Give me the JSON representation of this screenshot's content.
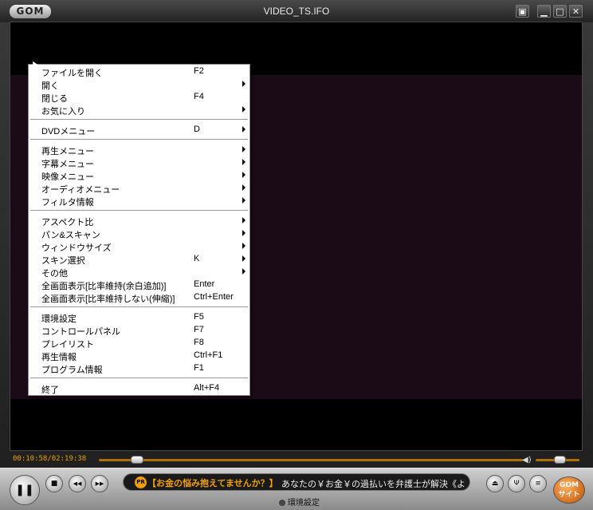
{
  "app": {
    "logo_text": "GOM",
    "title": "VIDEO_TS.IFO"
  },
  "window_buttons": {
    "compact": "▣",
    "minimize": "▁",
    "maximize": "□",
    "close": "✕"
  },
  "context_menu": {
    "items": [
      {
        "label": "ファイルを開く",
        "shortcut": "F2",
        "submenu": false
      },
      {
        "label": "開く",
        "shortcut": "",
        "submenu": true
      },
      {
        "label": "閉じる",
        "shortcut": "F4",
        "submenu": false
      },
      {
        "label": "お気に入り",
        "shortcut": "",
        "submenu": true
      },
      {
        "label": "DVDメニュー",
        "shortcut": "D",
        "submenu": true
      },
      {
        "label": "再生メニュー",
        "shortcut": "",
        "submenu": true
      },
      {
        "label": "字幕メニュー",
        "shortcut": "",
        "submenu": true
      },
      {
        "label": "映像メニュー",
        "shortcut": "",
        "submenu": true
      },
      {
        "label": "オーディオメニュー",
        "shortcut": "",
        "submenu": true
      },
      {
        "label": "フィルタ情報",
        "shortcut": "",
        "submenu": true
      },
      {
        "label": "アスペクト比",
        "shortcut": "",
        "submenu": true
      },
      {
        "label": "パン&スキャン",
        "shortcut": "",
        "submenu": true
      },
      {
        "label": "ウィンドウサイズ",
        "shortcut": "",
        "submenu": true
      },
      {
        "label": "スキン選択",
        "shortcut": "K",
        "submenu": true
      },
      {
        "label": "その他",
        "shortcut": "",
        "submenu": true
      },
      {
        "label": "全画面表示[比率維持(余白追加)]",
        "shortcut": "Enter",
        "submenu": false
      },
      {
        "label": "全画面表示[比率維持しない(伸縮)]",
        "shortcut": "Ctrl+Enter",
        "submenu": false
      },
      {
        "label": "環境設定",
        "shortcut": "F5",
        "submenu": false
      },
      {
        "label": "コントロールパネル",
        "shortcut": "F7",
        "submenu": false
      },
      {
        "label": "プレイリスト",
        "shortcut": "F8",
        "submenu": false
      },
      {
        "label": "再生情報",
        "shortcut": "Ctrl+F1",
        "submenu": false
      },
      {
        "label": "プログラム情報",
        "shortcut": "F1",
        "submenu": false
      },
      {
        "label": "終了",
        "shortcut": "Alt+F4",
        "submenu": false
      }
    ]
  },
  "seek": {
    "time": "00:10:58/02:19:38",
    "position_fraction": 0.08,
    "volume_fraction": 0.45
  },
  "controls": {
    "play_pause": "❚❚",
    "stop": "■",
    "prev": "◀◀",
    "next": "▶▶",
    "eject": "⏏",
    "equalizer": "Ψ",
    "menu": "≡",
    "gom_site_line1": "GOM",
    "gom_site_line2": "サイト",
    "prefs_label": "環境設定"
  },
  "ticker": {
    "badge": "PR",
    "headline": "【お金の悩み抱えてませんか？】",
    "text": "あなたの￥お金￥の過払いを弁護士が解決《よ"
  },
  "colors": {
    "accent": "#f0a000",
    "menu_bg": "#ffffff",
    "video_bg": "#000000"
  }
}
